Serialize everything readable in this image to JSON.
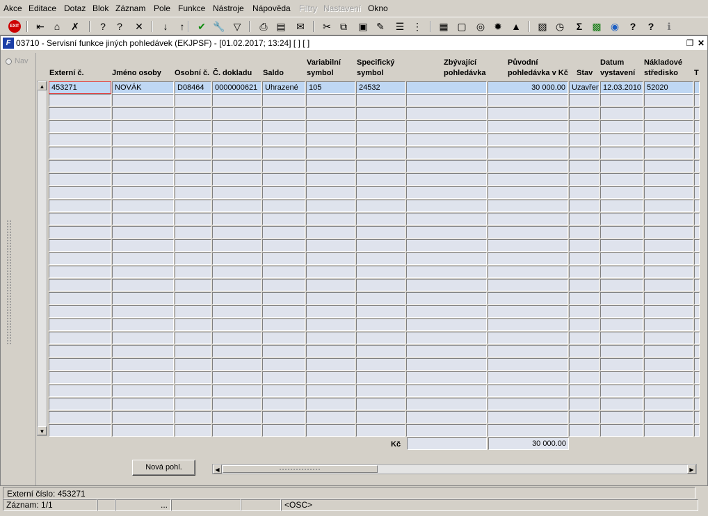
{
  "menu": [
    {
      "label": "Akce",
      "disabled": false
    },
    {
      "label": "Editace",
      "disabled": false
    },
    {
      "label": "Dotaz",
      "disabled": false
    },
    {
      "label": "Blok",
      "disabled": false
    },
    {
      "label": "Záznam",
      "disabled": false
    },
    {
      "label": "Pole",
      "disabled": false
    },
    {
      "label": "Funkce",
      "disabled": false
    },
    {
      "label": "Nástroje",
      "disabled": false
    },
    {
      "label": "Nápověda",
      "disabled": false
    },
    {
      "label": "Filtry",
      "disabled": true
    },
    {
      "label": "Nastavení",
      "disabled": true
    },
    {
      "label": "Okno",
      "disabled": false
    }
  ],
  "toolbar": {
    "exit_label": "EXIT",
    "icons": [
      "exit-icon",
      "save-icon",
      "new-record-icon",
      "delete-record-icon",
      "query-icon",
      "execute-query-icon",
      "cancel-query-icon",
      "sort-asc-icon",
      "sort-desc-icon",
      "check-icon",
      "tools-icon",
      "filter-icon",
      "print-icon",
      "report-icon",
      "mail-icon",
      "cut-icon",
      "copy-icon",
      "paste-icon",
      "edit-icon",
      "list-icon",
      "tree-icon",
      "calendar-icon",
      "document-icon",
      "globe-icon",
      "settings-icon",
      "warning-icon",
      "chart-icon",
      "clock-icon",
      "sum-icon",
      "excel-icon",
      "browser-icon",
      "help-icon",
      "help-context-icon",
      "info-icon"
    ]
  },
  "window": {
    "title": "03710 - Servisní funkce jiných pohledávek (EKJPSF) - [01.02.2017; 13:24] [ ] [ ]",
    "icon_letter": "F"
  },
  "nav": {
    "label": "Nav"
  },
  "columns": [
    {
      "line1": "",
      "line2": "Externí č."
    },
    {
      "line1": "",
      "line2": "Jméno osoby"
    },
    {
      "line1": "",
      "line2": "Osobní č."
    },
    {
      "line1": "",
      "line2": "Č. dokladu"
    },
    {
      "line1": "",
      "line2": "Saldo"
    },
    {
      "line1": "Variabilní",
      "line2": "symbol"
    },
    {
      "line1": "Specifický",
      "line2": "symbol"
    },
    {
      "line1": "Zbývající",
      "line2": "pohledávka"
    },
    {
      "line1": "Původní",
      "line2": "pohledávka v Kč"
    },
    {
      "line1": "",
      "line2": "Stav"
    },
    {
      "line1": "Datum",
      "line2": "vystavení"
    },
    {
      "line1": "Nákladové",
      "line2": "středisko"
    },
    {
      "line1": "",
      "line2": "T"
    }
  ],
  "rows": [
    [
      "453271",
      "NOVÁK",
      "D08464",
      "0000000621",
      "Uhrazené",
      "105",
      "24532",
      "",
      "30 000.00",
      "Uzavřen",
      "12.03.2010",
      "52020",
      ""
    ]
  ],
  "empty_rows": 26,
  "totals": {
    "label": "Kč",
    "zbyvajici": "",
    "puvodni": "30 000.00"
  },
  "nova_button": "Nová pohl.",
  "status": {
    "line1": "Externí číslo: 453271",
    "record": "Záznam: 1/1",
    "seg3": "...",
    "osc": "<OSC>"
  }
}
